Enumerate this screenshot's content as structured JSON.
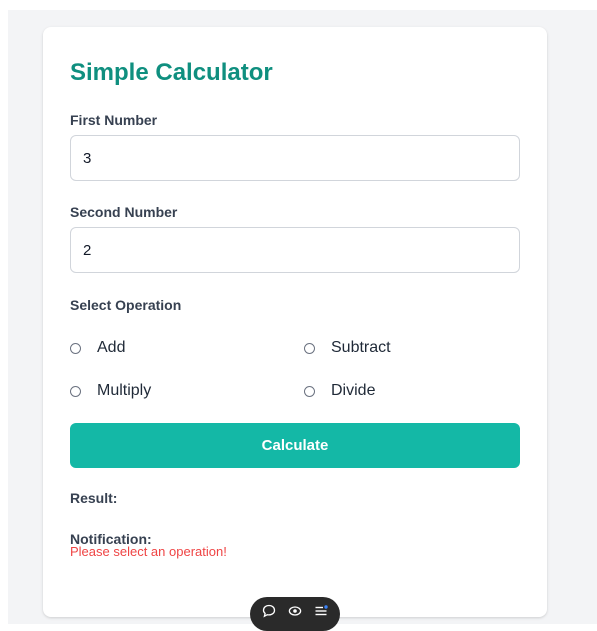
{
  "calculator": {
    "title": "Simple Calculator",
    "first_number": {
      "label": "First Number",
      "value": "3"
    },
    "second_number": {
      "label": "Second Number",
      "value": "2"
    },
    "operation": {
      "label": "Select Operation",
      "options": [
        "Add",
        "Subtract",
        "Multiply",
        "Divide"
      ]
    },
    "calculate_label": "Calculate",
    "result_label": "Result:",
    "notification_label": "Notification:",
    "error_message": "Please select an operation!"
  },
  "toolbar": {
    "icons": [
      "chat-bubble-icon",
      "eye-icon",
      "list-menu-icon"
    ]
  },
  "colors": {
    "title": "#0f8f7f",
    "button": "#14b8a6",
    "error": "#ef4444",
    "background": "#f3f4f6"
  }
}
